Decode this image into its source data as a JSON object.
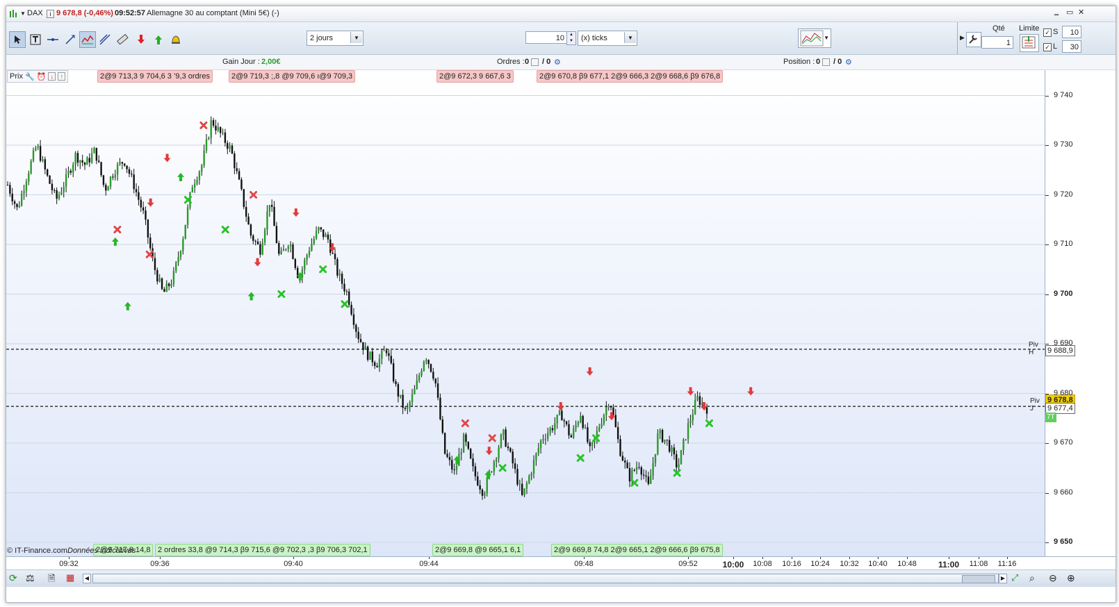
{
  "titlebar": {
    "symbol": "DAX",
    "price_change": "9 678,8 (-0,46%)",
    "time": "09:52:57",
    "instrument": "Allemagne 30 au comptant (Mini 5€) (-)"
  },
  "toolbar": {
    "period": "2 jours",
    "ticks_value": "10",
    "ticks_label": "(x) ticks",
    "qty_label": "Qté",
    "qty_value": "1",
    "limite_label": "Limite",
    "s_label": "S",
    "s_value": "10",
    "l_label": "L",
    "l_value": "30"
  },
  "infobar": {
    "gain_label": "Gain Jour :",
    "gain_value": "2,00€",
    "ordres_label": "Ordres :",
    "ordres_value": "0",
    "ordres_sep": "/ 0",
    "position_label": "Position :",
    "position_value": "0",
    "position_sep": "/ 0"
  },
  "chart_header": {
    "prix_label": "Prix"
  },
  "top_tags": [
    "2@9 713,3 9 704,6 3 ’9,3 ordres",
    "2@9 719,3 ;,8 @9 709,6 ı@9 709,3",
    "2@9 672,3 9 667,6 3",
    "2@9 670,8 β9 677,1 2@9 666,3 2@9 668,6 β9 676,8"
  ],
  "bottom_tags": [
    "2@9 717,8 14,8",
    "2 ordres 33,8 @9 714,3 β9 715,6 @9 702,3 ,3 β9 706,3 702,1",
    "2@9 669,8 @9 665,1 6,1",
    "2@9 669,8 74,8 2@9 665,1 2@9 666,6 β9 675,8"
  ],
  "footer_left": {
    "copyright": "© IT-Finance.com",
    "note": "Données indicatives"
  },
  "yaxis": {
    "ticks": [
      "9 740",
      "9 730",
      "9 720",
      "9 710",
      "9 700",
      "9 690",
      "9 680",
      "9 670",
      "9 660",
      "9 650"
    ],
    "piv_h_label": "Piv H",
    "piv_h_value": "9 688,9",
    "piv_j_label": "Piv J",
    "piv_j_value": "9 677,4",
    "last_price": "9 678,8",
    "last_tag": "7T"
  },
  "xaxis": {
    "labels": [
      "09:32",
      "09:36",
      "09:40",
      "09:44",
      "09:48",
      "09:52",
      "10:00",
      "10:08",
      "10:16",
      "10:24",
      "10:32",
      "10:40",
      "10:48",
      "11:00",
      "11:08",
      "11:16"
    ]
  },
  "chart_data": {
    "type": "candlestick",
    "ylim": [
      9648,
      9745
    ],
    "piv_h": 9688.9,
    "piv_j": 9677.4,
    "last": 9678.8,
    "path": [
      9722,
      9717,
      9724,
      9730,
      9724,
      9719,
      9723,
      9728,
      9726,
      9729,
      9721,
      9725,
      9727,
      9722,
      9716,
      9706,
      9700,
      9703,
      9711,
      9722,
      9726,
      9735,
      9732,
      9729,
      9721,
      9712,
      9709,
      9719,
      9707,
      9711,
      9703,
      9709,
      9713,
      9711,
      9704,
      9700,
      9692,
      9688,
      9686,
      9689,
      9681,
      9676,
      9681,
      9688,
      9683,
      9668,
      9664,
      9671,
      9664,
      9660,
      9666,
      9672,
      9666,
      9659,
      9665,
      9671,
      9673,
      9676,
      9671,
      9676,
      9668,
      9674,
      9679,
      9669,
      9663,
      9666,
      9661,
      9672,
      9670,
      9665,
      9673,
      9679,
      9677
    ],
    "sell_arrows": [
      [
        9727,
        0.155
      ],
      [
        9718,
        0.139
      ],
      [
        9706,
        0.242
      ],
      [
        9716,
        0.279
      ],
      [
        9709,
        0.314
      ],
      [
        9677,
        0.534
      ],
      [
        9684,
        0.562
      ],
      [
        9680,
        0.659
      ],
      [
        9680,
        0.717
      ],
      [
        9668,
        0.465
      ],
      [
        9675,
        0.583
      ],
      [
        9677,
        0.672
      ]
    ],
    "buy_arrows": [
      [
        9711,
        0.105
      ],
      [
        9698,
        0.117
      ],
      [
        9724,
        0.168
      ],
      [
        9704,
        0.283
      ],
      [
        9667,
        0.434
      ],
      [
        9664,
        0.464
      ],
      [
        9700,
        0.236
      ]
    ],
    "x_marks_red": [
      [
        9734,
        0.19
      ],
      [
        9713,
        0.107
      ],
      [
        9708,
        0.138
      ],
      [
        9720,
        0.238
      ],
      [
        9674,
        0.442
      ],
      [
        9671,
        0.468
      ]
    ],
    "x_marks_green": [
      [
        9719,
        0.175
      ],
      [
        9713,
        0.211
      ],
      [
        9700,
        0.265
      ],
      [
        9705,
        0.305
      ],
      [
        9698,
        0.326
      ],
      [
        9665,
        0.478
      ],
      [
        9667,
        0.553
      ],
      [
        9671,
        0.568
      ],
      [
        9662,
        0.605
      ],
      [
        9664,
        0.646
      ],
      [
        9674,
        0.677
      ]
    ]
  }
}
